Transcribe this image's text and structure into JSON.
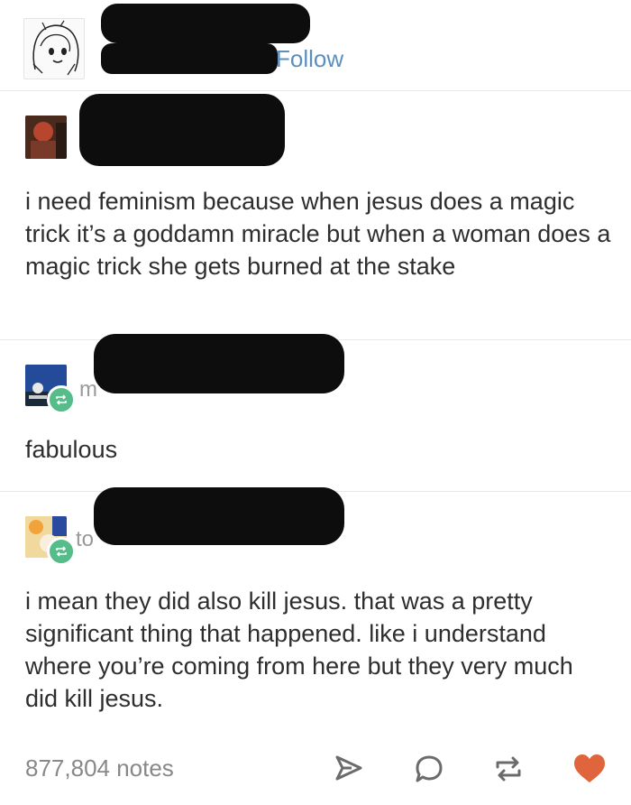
{
  "header": {
    "follow_label": "Follow"
  },
  "posts": [
    {
      "text": "i need feminism because when jesus does a magic trick it’s a goddamn miracle but when a woman does a magic trick she gets burned at the stake"
    },
    {
      "text": "fabulous",
      "username_partial": "m"
    },
    {
      "text": "i mean they did also kill jesus. that was a pretty significant thing that happened. like i understand where you’re coming from here but they very much did kill jesus.",
      "username_partial": "to"
    }
  ],
  "footer": {
    "notes": "877,804 notes"
  },
  "colors": {
    "accent": "#5a8fbf",
    "reblog": "#56bc8a",
    "like": "#e0653c",
    "redaction": "#0d0d0d"
  },
  "icons": [
    "share-icon",
    "reply-icon",
    "reblog-icon",
    "like-icon"
  ]
}
